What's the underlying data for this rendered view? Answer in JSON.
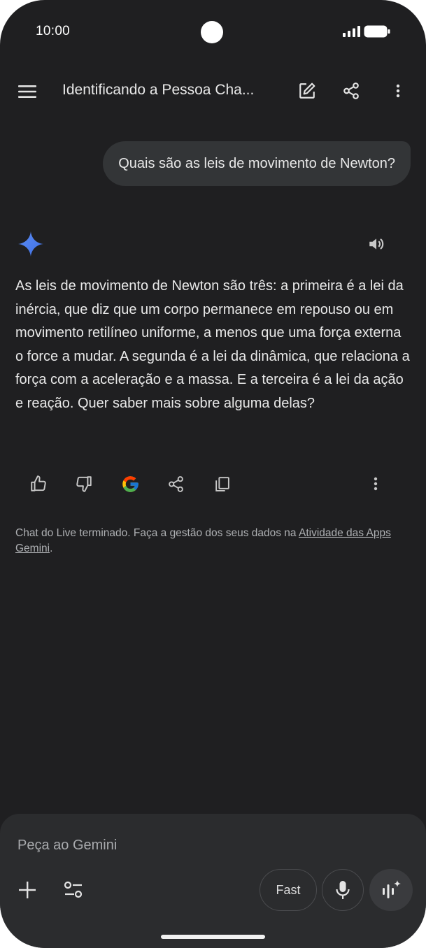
{
  "status_bar": {
    "time": "10:00"
  },
  "app_bar": {
    "title": "Identificando a Pessoa Cha..."
  },
  "conversation": {
    "user_message": "Quais são as leis de movimento de Newton?",
    "response": "As leis de movimento de Newton são três: a primeira é a lei da inércia, que diz que um corpo permanece em repouso ou em movimento retilíneo uniforme, a menos que uma força externa o force a mudar. A segunda é a lei da dinâmica, que relaciona a força com a aceleração e a massa. E a terceira é a lei da ação e reação. Quer saber mais sobre alguma delas?"
  },
  "response_actions": [
    "thumbs-up-icon",
    "thumbs-down-icon",
    "google-icon",
    "share-icon",
    "copy-icon",
    "more-vert-icon"
  ],
  "footnote": {
    "text": "Chat do Live terminado. Faça a gestão dos seus dados na ",
    "link": "Atividade das Apps Gemini",
    "end": "."
  },
  "composer": {
    "placeholder": "Peça ao Gemini",
    "fast_label": "Fast"
  },
  "colors": {
    "background": "#1f1f21",
    "bubble": "#333537",
    "composer": "#2b2c2e",
    "gemini_star": "#4f86f7"
  }
}
